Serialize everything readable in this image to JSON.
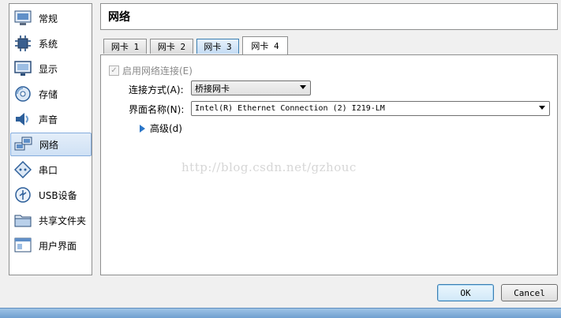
{
  "sidebar": {
    "items": [
      {
        "label": "常规",
        "icon": "general-icon"
      },
      {
        "label": "系统",
        "icon": "system-chip-icon"
      },
      {
        "label": "显示",
        "icon": "monitor-icon"
      },
      {
        "label": "存储",
        "icon": "storage-disc-icon"
      },
      {
        "label": "声音",
        "icon": "speaker-icon"
      },
      {
        "label": "网络",
        "icon": "network-icon",
        "active": true
      },
      {
        "label": "串口",
        "icon": "serial-port-icon"
      },
      {
        "label": "USB设备",
        "icon": "usb-icon"
      },
      {
        "label": "共享文件夹",
        "icon": "shared-folder-icon"
      },
      {
        "label": "用户界面",
        "icon": "user-interface-icon"
      }
    ]
  },
  "header": {
    "title": "网络"
  },
  "tabs": [
    {
      "label": "网卡 1"
    },
    {
      "label": "网卡 2"
    },
    {
      "label": "网卡 3"
    },
    {
      "label": "网卡 4"
    }
  ],
  "form": {
    "enable_label": "启用网络连接(E)",
    "enable_checked": true,
    "attached_label": "连接方式(A):",
    "attached_value": "桥接网卡",
    "name_label": "界面名称(N):",
    "name_value": "Intel(R) Ethernet Connection (2) I219-LM",
    "advanced_label": "高级(d)"
  },
  "watermark": "http://blog.csdn.net/gzhouc",
  "buttons": {
    "ok": "OK",
    "cancel": "Cancel"
  },
  "colors": {
    "accent": "#3c7fb1",
    "selection": "#cfe1f5"
  }
}
